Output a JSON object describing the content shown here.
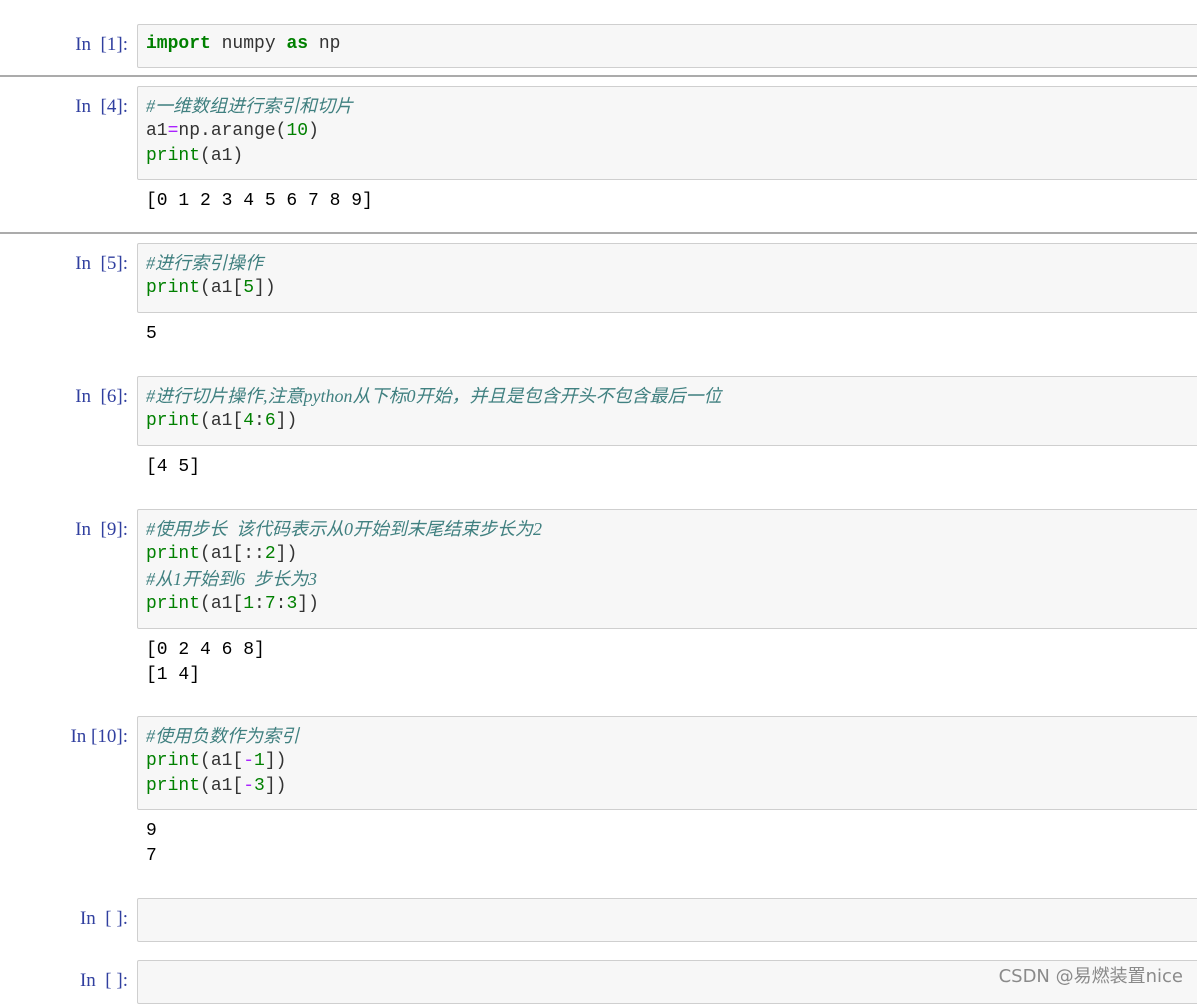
{
  "cells": [
    {
      "prompt": "In  [1]:",
      "lines": [
        [
          {
            "t": "kw",
            "v": "import"
          },
          {
            "t": "tx",
            "v": " numpy "
          },
          {
            "t": "kw",
            "v": "as"
          },
          {
            "t": "tx",
            "v": " np"
          }
        ]
      ],
      "output": []
    },
    {
      "prompt": "In  [4]:",
      "lines": [
        [
          {
            "t": "cm",
            "v": "#一维数组进行索引和切片"
          }
        ],
        [
          {
            "t": "tx",
            "v": "a1"
          },
          {
            "t": "op",
            "v": "="
          },
          {
            "t": "tx",
            "v": "np.arange("
          },
          {
            "t": "num",
            "v": "10"
          },
          {
            "t": "tx",
            "v": ")"
          }
        ],
        [
          {
            "t": "bi",
            "v": "print"
          },
          {
            "t": "tx",
            "v": "(a1)"
          }
        ]
      ],
      "output": [
        "[0 1 2 3 4 5 6 7 8 9]"
      ]
    },
    {
      "prompt": "In  [5]:",
      "lines": [
        [
          {
            "t": "cm",
            "v": "#进行索引操作"
          }
        ],
        [
          {
            "t": "bi",
            "v": "print"
          },
          {
            "t": "tx",
            "v": "(a1["
          },
          {
            "t": "num",
            "v": "5"
          },
          {
            "t": "tx",
            "v": "])"
          }
        ]
      ],
      "output": [
        "5"
      ]
    },
    {
      "prompt": "In  [6]:",
      "lines": [
        [
          {
            "t": "cm",
            "v": "#进行切片操作,注意python从下标0开始，并且是包含开头不包含最后一位"
          }
        ],
        [
          {
            "t": "bi",
            "v": "print"
          },
          {
            "t": "tx",
            "v": "(a1["
          },
          {
            "t": "num",
            "v": "4"
          },
          {
            "t": "tx",
            "v": ":"
          },
          {
            "t": "num",
            "v": "6"
          },
          {
            "t": "tx",
            "v": "])"
          }
        ]
      ],
      "output": [
        "[4 5]"
      ]
    },
    {
      "prompt": "In  [9]:",
      "lines": [
        [
          {
            "t": "cm",
            "v": "#使用步长  该代码表示从0开始到末尾结束步长为2"
          }
        ],
        [
          {
            "t": "bi",
            "v": "print"
          },
          {
            "t": "tx",
            "v": "(a1[::"
          },
          {
            "t": "num",
            "v": "2"
          },
          {
            "t": "tx",
            "v": "])"
          }
        ],
        [
          {
            "t": "cm",
            "v": "#从1开始到6  步长为3"
          }
        ],
        [
          {
            "t": "bi",
            "v": "print"
          },
          {
            "t": "tx",
            "v": "(a1["
          },
          {
            "t": "num",
            "v": "1"
          },
          {
            "t": "tx",
            "v": ":"
          },
          {
            "t": "num",
            "v": "7"
          },
          {
            "t": "tx",
            "v": ":"
          },
          {
            "t": "num",
            "v": "3"
          },
          {
            "t": "tx",
            "v": "])"
          }
        ]
      ],
      "output": [
        "[0 2 4 6 8]",
        "[1 4]"
      ]
    },
    {
      "prompt": "In [10]:",
      "lines": [
        [
          {
            "t": "cm",
            "v": "#使用负数作为索引"
          }
        ],
        [
          {
            "t": "bi",
            "v": "print"
          },
          {
            "t": "tx",
            "v": "(a1["
          },
          {
            "t": "op",
            "v": "-"
          },
          {
            "t": "num",
            "v": "1"
          },
          {
            "t": "tx",
            "v": "])"
          }
        ],
        [
          {
            "t": "bi",
            "v": "print"
          },
          {
            "t": "tx",
            "v": "(a1["
          },
          {
            "t": "op",
            "v": "-"
          },
          {
            "t": "num",
            "v": "3"
          },
          {
            "t": "tx",
            "v": "])"
          }
        ]
      ],
      "output": [
        "9",
        "7"
      ]
    },
    {
      "prompt": "In  [ ]:",
      "lines": [],
      "output": []
    },
    {
      "prompt": "In  [ ]:",
      "lines": [],
      "output": []
    }
  ],
  "watermark": "CSDN @易燃装置nice"
}
